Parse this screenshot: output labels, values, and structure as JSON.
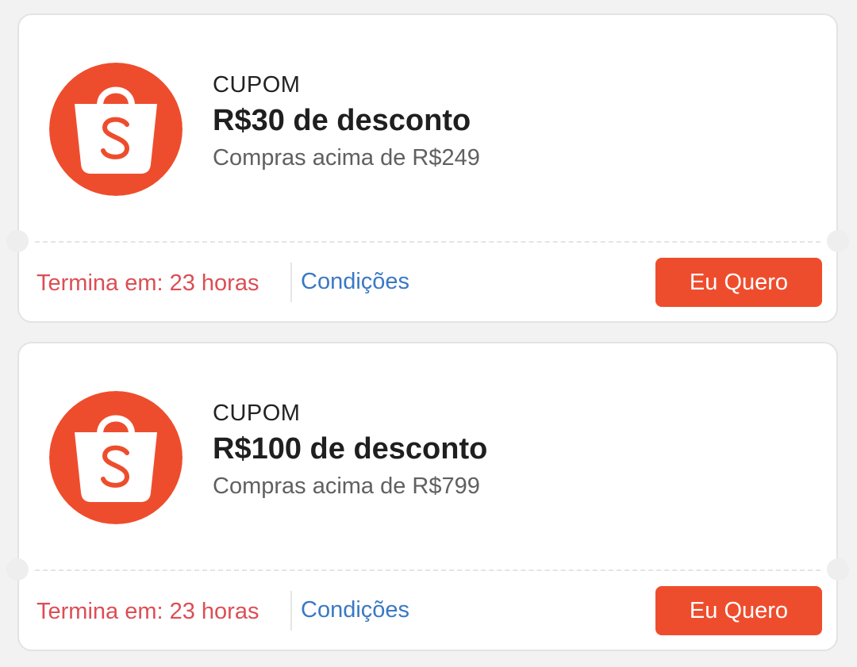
{
  "colors": {
    "brand": "#ee4d2d",
    "expiry": "#dc4e55",
    "link": "#3a78c4"
  },
  "coupons": [
    {
      "icon": "shopee-bag-icon",
      "label": "CUPOM",
      "title": "R$30 de desconto",
      "subtitle": "Compras acima de R$249",
      "expiry": "Termina em: 23 horas",
      "conditions": "Condições",
      "cta": "Eu Quero"
    },
    {
      "icon": "shopee-bag-icon",
      "label": "CUPOM",
      "title": "R$100 de desconto",
      "subtitle": "Compras acima de R$799",
      "expiry": "Termina em: 23 horas",
      "conditions": "Condições",
      "cta": "Eu Quero"
    }
  ]
}
